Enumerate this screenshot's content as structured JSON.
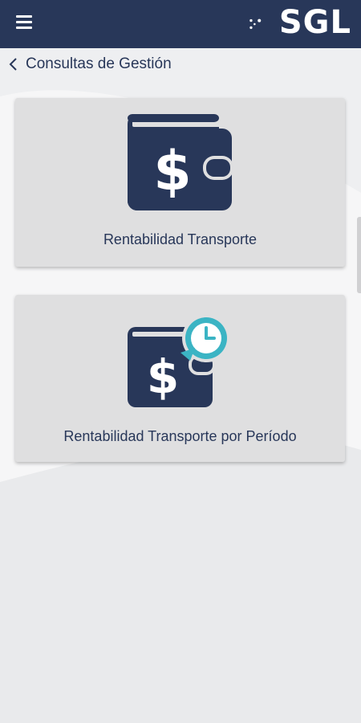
{
  "header": {
    "menu_icon": "hamburger-menu-icon",
    "logo_text": "SGL",
    "background_color": "#283759"
  },
  "breadcrumb": {
    "back_icon": "chevron-left-icon",
    "label": "Consultas de Gestión"
  },
  "cards": [
    {
      "icon": "wallet-dollar-icon",
      "label": "Rentabilidad Transporte"
    },
    {
      "icon": "wallet-dollar-history-icon",
      "label": "Rentabilidad Transporte por Período"
    }
  ],
  "colors": {
    "navy": "#283759",
    "accent_teal": "#3bb4c4",
    "card_background": "#dfdfe0"
  }
}
